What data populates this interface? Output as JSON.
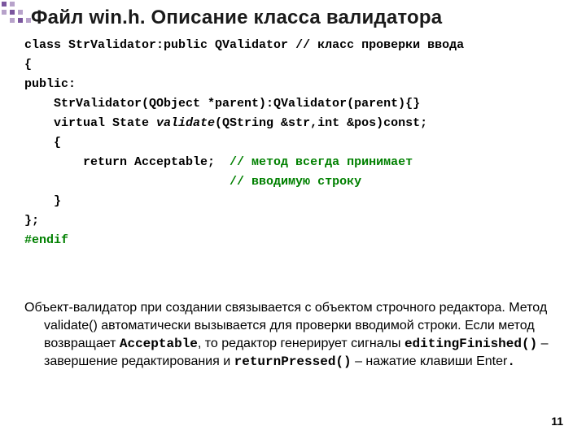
{
  "heading": "Файл win.h. Описание класса валидатора",
  "code": {
    "l1_a": "class StrValidator:public QValidator ",
    "l1_b": "// класс проверки ввода",
    "l2": "{",
    "l3": "public:",
    "l4": "    StrValidator(QObject *parent):QValidator(parent){}",
    "l5_a": "    virtual State ",
    "l5_b": "validate",
    "l5_c": "(QString &str,int &pos)const;",
    "l6": "    {",
    "l7_a": "        return Acceptable;  ",
    "l7_b": "// метод всегда принимает",
    "l8_a": "                            ",
    "l8_b": "// вводимую строку",
    "l9": "    }",
    "l10": "};",
    "l11": "#endif"
  },
  "para": {
    "t1": "Объект-валидатор при создании связывается с объектом строчного редактора. Метод validate() автоматически вызывается для проверки вводимой строки. Если метод возвращает ",
    "m1": "Acceptable",
    "t2": ", то редактор генерирует сигналы ",
    "m2": "editingFinished()",
    "t3": " – завершение редактирования и ",
    "m3": "returnPressed()",
    "t4": " – нажатие клавиши Enter",
    "dot": "."
  },
  "pagenum": "11"
}
